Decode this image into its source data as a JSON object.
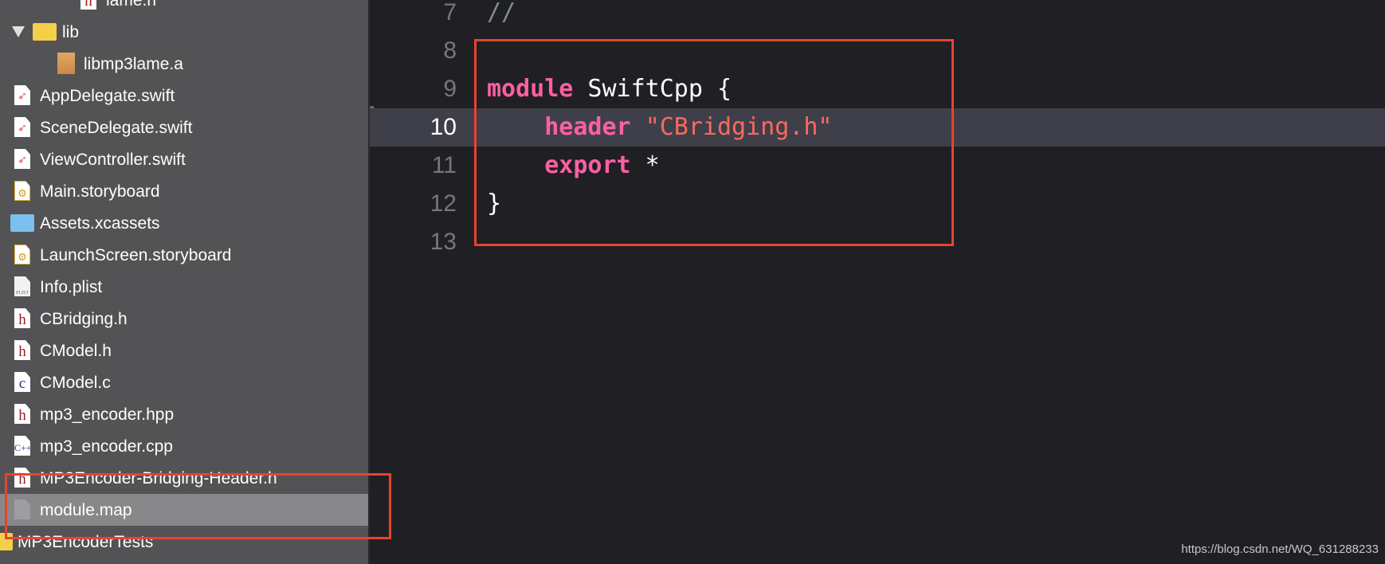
{
  "navigator": {
    "items": [
      {
        "label": "lame.h",
        "icon": "header-file-icon",
        "type": "h"
      },
      {
        "label": "lib",
        "icon": "folder-icon",
        "type": "folder",
        "expanded": true
      },
      {
        "label": "libmp3lame.a",
        "icon": "archive-icon",
        "type": "archive"
      },
      {
        "label": "AppDelegate.swift",
        "icon": "swift-file-icon",
        "type": "swift"
      },
      {
        "label": "SceneDelegate.swift",
        "icon": "swift-file-icon",
        "type": "swift"
      },
      {
        "label": "ViewController.swift",
        "icon": "swift-file-icon",
        "type": "swift"
      },
      {
        "label": "Main.storyboard",
        "icon": "storyboard-icon",
        "type": "sb"
      },
      {
        "label": "Assets.xcassets",
        "icon": "assets-folder-icon",
        "type": "assets"
      },
      {
        "label": "LaunchScreen.storyboard",
        "icon": "storyboard-icon",
        "type": "sb"
      },
      {
        "label": "Info.plist",
        "icon": "plist-icon",
        "type": "plist"
      },
      {
        "label": "CBridging.h",
        "icon": "header-file-icon",
        "type": "h"
      },
      {
        "label": "CModel.h",
        "icon": "header-file-icon",
        "type": "h"
      },
      {
        "label": "CModel.c",
        "icon": "c-file-icon",
        "type": "c"
      },
      {
        "label": "mp3_encoder.hpp",
        "icon": "header-file-icon",
        "type": "h"
      },
      {
        "label": "mp3_encoder.cpp",
        "icon": "cpp-file-icon",
        "type": "cpp"
      },
      {
        "label": "MP3Encoder-Bridging-Header.h",
        "icon": "header-file-icon",
        "type": "h"
      },
      {
        "label": "module.map",
        "icon": "blank-file-icon",
        "type": "blank",
        "selected": true
      },
      {
        "label": "MP3EncoderTests",
        "icon": "folder-icon",
        "type": "group"
      }
    ],
    "icon_glyphs": {
      "h": "h",
      "c": "c",
      "cpp": "C++",
      "swift": "➶",
      "sb": "⚙",
      "plist": "PLIST"
    }
  },
  "editor": {
    "current_line": 10,
    "lines": [
      {
        "num": "7",
        "tokens": [
          {
            "t": "//",
            "c": "cmt"
          }
        ]
      },
      {
        "num": "8",
        "tokens": []
      },
      {
        "num": "9",
        "tokens": [
          {
            "t": "module",
            "c": "kw"
          },
          {
            "t": " SwiftCpp {",
            "c": ""
          }
        ]
      },
      {
        "num": "10",
        "tokens": [
          {
            "t": "    ",
            "c": ""
          },
          {
            "t": "header",
            "c": "kw"
          },
          {
            "t": " ",
            "c": ""
          },
          {
            "t": "\"CBridging.h\"",
            "c": "str"
          }
        ]
      },
      {
        "num": "11",
        "tokens": [
          {
            "t": "    ",
            "c": ""
          },
          {
            "t": "export",
            "c": "kw"
          },
          {
            "t": " *",
            "c": ""
          }
        ]
      },
      {
        "num": "12",
        "tokens": [
          {
            "t": "}",
            "c": ""
          }
        ]
      },
      {
        "num": "13",
        "tokens": []
      }
    ]
  },
  "annotation_color": "#e8432e",
  "watermark": "https://blog.csdn.net/WQ_631288233"
}
